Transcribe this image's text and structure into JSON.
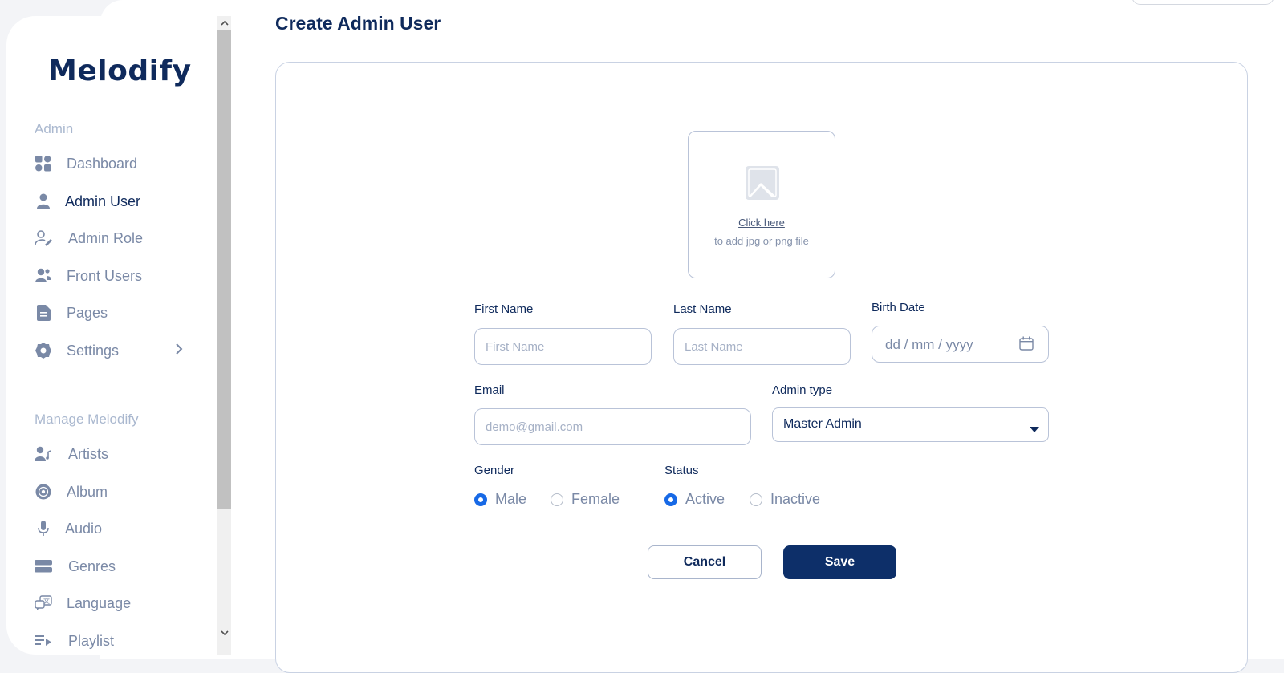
{
  "app": {
    "logo": "Melodify"
  },
  "sidebar": {
    "section_admin": "Admin",
    "section_manage": "Manage Melodify",
    "items": [
      {
        "label": "Dashboard",
        "icon": "dashboard-icon"
      },
      {
        "label": "Admin User",
        "icon": "user-icon",
        "active": true
      },
      {
        "label": "Admin Role",
        "icon": "user-edit-icon"
      },
      {
        "label": "Front Users",
        "icon": "users-icon"
      },
      {
        "label": "Pages",
        "icon": "document-icon"
      },
      {
        "label": "Settings",
        "icon": "gear-icon"
      }
    ],
    "manage_items": [
      {
        "label": "Artists",
        "icon": "artist-icon"
      },
      {
        "label": "Album",
        "icon": "disc-icon"
      },
      {
        "label": "Audio",
        "icon": "microphone-icon"
      },
      {
        "label": "Genres",
        "icon": "genres-icon"
      },
      {
        "label": "Language",
        "icon": "language-icon"
      },
      {
        "label": "Playlist",
        "icon": "playlist-icon"
      }
    ]
  },
  "page": {
    "title": "Create Admin User"
  },
  "form": {
    "upload": {
      "link": "Click here",
      "hint": "to add jpg or png file"
    },
    "first_name": {
      "label": "First Name",
      "placeholder": "First Name"
    },
    "last_name": {
      "label": "Last Name",
      "placeholder": "Last Name"
    },
    "birth_date": {
      "label": "Birth Date",
      "placeholder": "dd / mm / yyyy"
    },
    "email": {
      "label": "Email",
      "placeholder": "demo@gmail.com"
    },
    "admin_type": {
      "label": "Admin type",
      "value": "Master Admin"
    },
    "gender": {
      "label": "Gender",
      "options": [
        "Male",
        "Female"
      ],
      "selected": "Male"
    },
    "status": {
      "label": "Status",
      "options": [
        "Active",
        "Inactive"
      ],
      "selected": "Active"
    },
    "cancel_label": "Cancel",
    "save_label": "Save"
  },
  "colors": {
    "primary": "#0d2f69",
    "radio_accent": "#1769e6",
    "muted": "#7a89a6"
  }
}
